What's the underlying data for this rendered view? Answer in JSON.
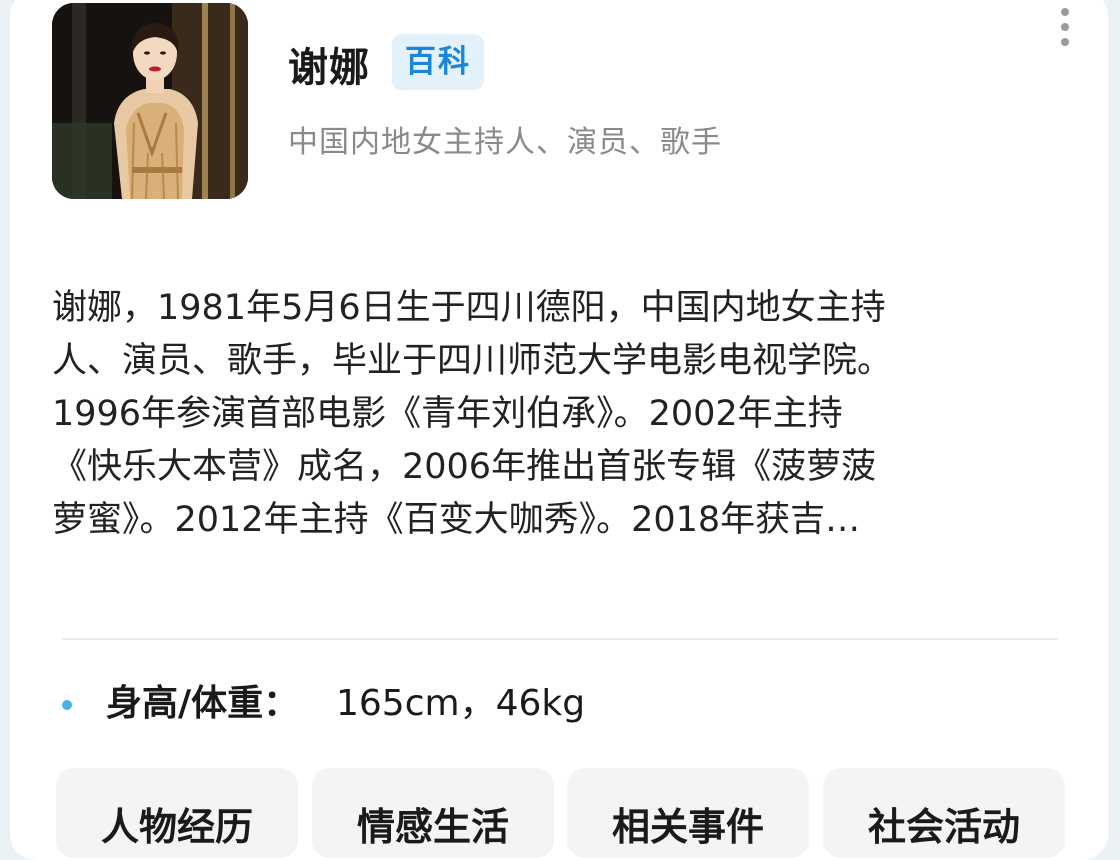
{
  "header": {
    "name": "谢娜",
    "badge": "百科",
    "subtitle": "中国内地女主持人、演员、歌手",
    "more_icon": "more-vertical-icon"
  },
  "summary": {
    "lines": [
      "谢娜，1981年5月6日生于四川德阳，中国内地女主持",
      "人、演员、歌手，毕业于四川师范大学电影电视学院。",
      "1996年参演首部电影《青年刘伯承》。2002年主持",
      "《快乐大本营》成名，2006年推出首张专辑《菠萝菠",
      "萝蜜》。2012年主持《百变大咖秀》。2018年获吉…"
    ]
  },
  "attributes": [
    {
      "label": "身高/体重：",
      "value": "165cm，46kg"
    }
  ],
  "tabs": [
    {
      "label": "人物经历"
    },
    {
      "label": "情感生活"
    },
    {
      "label": "相关事件"
    },
    {
      "label": "社会活动"
    }
  ],
  "colors": {
    "accent": "#1b86d8",
    "badge_bg": "#e3f1fb",
    "bullet": "#46b2e8",
    "subtitle": "#8a8a8a",
    "tab_bg": "#f2f4f6"
  }
}
